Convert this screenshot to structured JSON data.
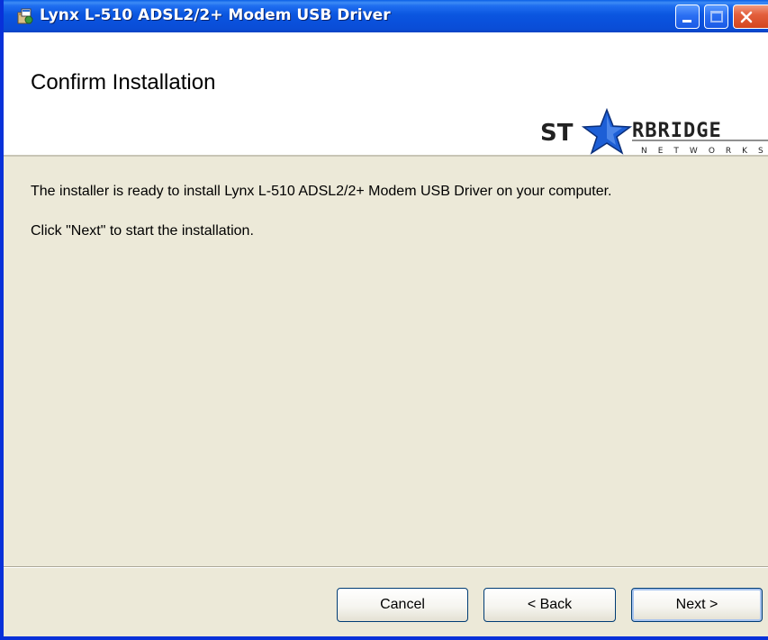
{
  "window": {
    "title": "Lynx L-510 ADSL2/2+ Modem USB Driver",
    "icon": "installer-package-icon",
    "controls": {
      "minimize": "minimize-icon",
      "maximize": "maximize-icon",
      "close": "close-icon"
    }
  },
  "banner": {
    "title": "Confirm Installation",
    "logo": "starbridge-networks-logo"
  },
  "content": {
    "message": "The installer is ready to install Lynx L-510 ADSL2/2+ Modem USB Driver on your computer.",
    "instruction": "Click \"Next\" to start the installation."
  },
  "footer": {
    "cancel_label": "Cancel",
    "back_label": "< Back",
    "next_label": "Next >"
  },
  "colors": {
    "titlebar": "#0a50db",
    "dialog_face": "#ece9d8",
    "close_button": "#d4451f",
    "logo_star": "#1d5fd6"
  }
}
